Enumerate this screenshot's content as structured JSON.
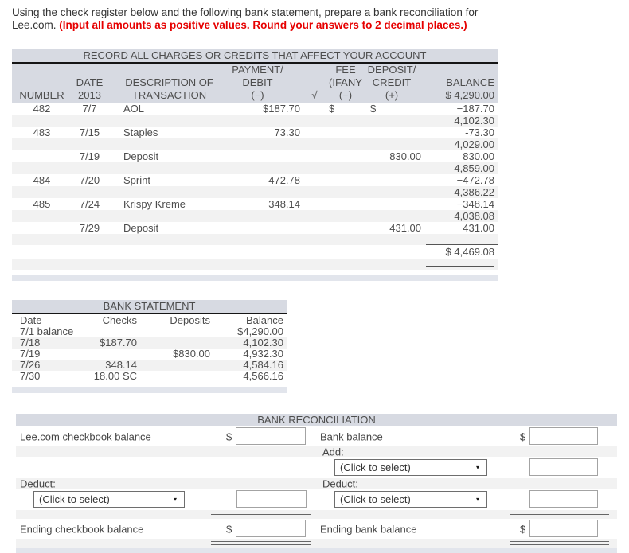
{
  "instructions": {
    "line1": "Using the check register below and the following bank statement, prepare a bank reconciliation for",
    "line2_normal": "Lee.com. ",
    "line2_red": "(Input all amounts as positive values. Round your answers to 2 decimal places.)"
  },
  "register": {
    "title": "RECORD ALL CHARGES OR CREDITS THAT AFFECT YOUR ACCOUNT",
    "header": {
      "number": "NUMBER",
      "date1": "DATE",
      "date2": "2013",
      "desc1": "DESCRIPTION OF",
      "desc2": "TRANSACTION",
      "pay1": "PAYMENT/",
      "pay2": "DEBIT",
      "pay3": "(−)",
      "check": "√",
      "fee1": "FEE",
      "fee2": "(IFANY)",
      "fee3": "(−)",
      "dep1": "DEPOSIT/",
      "dep2": "CREDIT",
      "dep3": "(+)",
      "bal1": "BALANCE",
      "bal2": "$ 4,290.00"
    },
    "rows": [
      [
        "482",
        "7/7",
        "AOL",
        "$187.70",
        "",
        "$",
        "$",
        "−187.70"
      ],
      [
        "",
        "",
        "",
        "",
        "",
        "",
        "",
        "4,102.30"
      ],
      [
        "483",
        "7/15",
        "Staples",
        "73.30",
        "",
        "",
        "",
        "-73.30"
      ],
      [
        "",
        "",
        "",
        "",
        "",
        "",
        "",
        "4,029.00"
      ],
      [
        "",
        "7/19",
        "Deposit",
        "",
        "",
        "",
        "830.00",
        "830.00"
      ],
      [
        "",
        "",
        "",
        "",
        "",
        "",
        "",
        "4,859.00"
      ],
      [
        "484",
        "7/20",
        "Sprint",
        "472.78",
        "",
        "",
        "",
        "−472.78"
      ],
      [
        "",
        "",
        "",
        "",
        "",
        "",
        "",
        "4,386.22"
      ],
      [
        "485",
        "7/24",
        "Krispy Kreme",
        "348.14",
        "",
        "",
        "",
        "−348.14"
      ],
      [
        "",
        "",
        "",
        "",
        "",
        "",
        "",
        "4,038.08"
      ],
      [
        "",
        "7/29",
        "Deposit",
        "",
        "",
        "",
        "431.00",
        "431.00"
      ]
    ],
    "total": "$ 4,469.08"
  },
  "bank_statement": {
    "title": "BANK STATEMENT",
    "headers": [
      "Date",
      "Checks",
      "Deposits",
      "Balance"
    ],
    "rows": [
      [
        "7/1 balance",
        "",
        "",
        "$4,290.00"
      ],
      [
        "7/18",
        "$187.70",
        "",
        "4,102.30"
      ],
      [
        "7/19",
        "",
        "$830.00",
        "4,932.30"
      ],
      [
        "7/26",
        "348.14",
        "",
        "4,584.16"
      ],
      [
        "7/30",
        "18.00 SC",
        "",
        "4,566.16"
      ]
    ]
  },
  "reconciliation": {
    "title": "BANK RECONCILIATION",
    "dollar": "$",
    "select_placeholder": "(Click to select)",
    "arrow": "▾",
    "left": {
      "balance_label": "Lee.com checkbook balance",
      "deduct_label": "Deduct:",
      "ending_label": "Ending checkbook balance"
    },
    "right": {
      "balance_label": "Bank balance",
      "add_label": "Add:",
      "deduct_label": "Deduct:",
      "ending_label": "Ending bank balance"
    }
  },
  "colors": {
    "header_bg": "#d7dae2",
    "row_shade": "#f2f2f2",
    "footer_bar": "#e2e5ec",
    "alert_red": "#e60000"
  }
}
